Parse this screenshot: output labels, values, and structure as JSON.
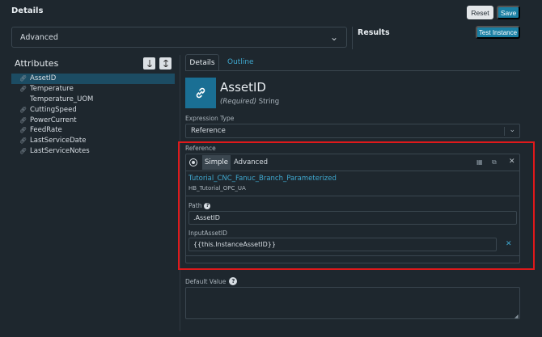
{
  "header": {
    "title": "Details",
    "reset_label": "Reset",
    "save_label": "Save",
    "mode_value": "Advanced",
    "results_label": "Results",
    "test_instance_label": "Test Instance"
  },
  "attributes": {
    "heading": "Attributes",
    "items": [
      {
        "label": "AssetID",
        "selected": true
      },
      {
        "label": "Temperature"
      },
      {
        "label": "Temperature_UOM"
      },
      {
        "label": "CuttingSpeed"
      },
      {
        "label": "PowerCurrent"
      },
      {
        "label": "FeedRate"
      },
      {
        "label": "LastServiceDate"
      },
      {
        "label": "LastServiceNotes"
      }
    ]
  },
  "tabs": {
    "details": "Details",
    "outline": "Outline"
  },
  "detail": {
    "name": "AssetID",
    "required_tag": "(Required)",
    "type": " String",
    "expression_type_label": "Expression Type",
    "expression_type_value": "Reference",
    "reference_label": "Reference",
    "mode_simple": "Simple",
    "mode_advanced": "Advanced",
    "node_name": "Tutorial_CNC_Fanuc_Branch_Parameterized",
    "node_source": "HB_Tutorial_OPC_UA",
    "path_label": "Path",
    "path_value": ".AssetID",
    "input_label": "InputAssetID",
    "input_value": "{{this.InstanceAssetID}}",
    "default_value_label": "Default Value"
  },
  "colors": {
    "background": "#1e272e",
    "accent": "#1a7fa3",
    "link": "#3fa8cf",
    "highlight": "#e0191b",
    "selected_row": "#1c4c63"
  }
}
